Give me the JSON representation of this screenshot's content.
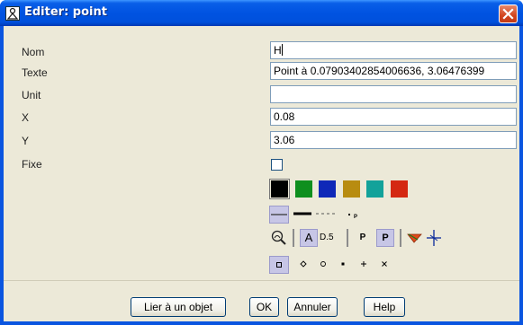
{
  "window": {
    "title": "Editer: point"
  },
  "form": {
    "nom_label": "Nom",
    "nom_value": "H",
    "texte_label": "Texte",
    "texte_value": "Point à 0.07903402854006636, 3.06476399",
    "unit_label": "Unit",
    "unit_value": "",
    "x_label": "X",
    "x_value": "0.08",
    "y_label": "Y",
    "y_value": "3.06",
    "fixe_label": "Fixe",
    "fixe_checked": false
  },
  "colors": {
    "swatches": [
      "#000000",
      "#0e8f1e",
      "#0f28b8",
      "#b88c10",
      "#12a29a",
      "#d42812"
    ],
    "selected_index": 0
  },
  "tools": {
    "text_a_label": "A",
    "decimal_label": "D.5",
    "p_label": "P",
    "p2_label": "P",
    "line_p_label": "P"
  },
  "point_styles": {
    "selected": "square",
    "items": [
      "square",
      "diamond",
      "circle",
      "dot",
      "cross",
      "x-mark"
    ]
  },
  "buttons": {
    "lier_label": "Lier à un objet",
    "ok_label": "OK",
    "annuler_label": "Annuler",
    "help_label": "Help"
  }
}
